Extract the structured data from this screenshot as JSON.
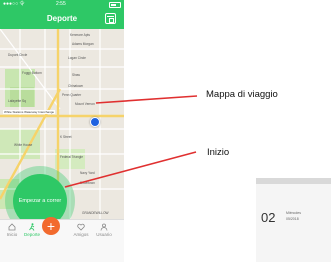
{
  "status_bar": {
    "carrier": "●●●○○ 令",
    "time": "2:55"
  },
  "nav": {
    "title": "Deporte",
    "calendar_icon": "calendar-icon"
  },
  "map": {
    "labels": [
      "Kenmore Apts",
      "Adams Morgan",
      "Dupont Circle",
      "Logan Circle",
      "Foggy Bottom",
      "Shaw",
      "Chinatown",
      "Penn Quarter",
      "Lafayette Sq",
      "Mount Vernon",
      "K Street",
      "White House",
      "Federal Triangle",
      "Navy Yard",
      "Downtown",
      "GRANDEWILLOW"
    ],
    "street_label": "White Stations Waterway Interchange"
  },
  "start_button": {
    "label": "Empezar a correr"
  },
  "tabs": [
    {
      "label": "Inicio",
      "icon": "home-icon"
    },
    {
      "label": "Deporte",
      "icon": "runner-icon"
    },
    {
      "label": "",
      "icon": "plus-icon"
    },
    {
      "label": "Amigos",
      "icon": "heart-icon"
    },
    {
      "label": "Usuario",
      "icon": "user-icon"
    }
  ],
  "annotations": {
    "map": "Mappa di viaggio",
    "start": "Inizio"
  },
  "second_screen": {
    "day": "02",
    "line1": "Miércoles",
    "line2": "05/2018"
  },
  "colors": {
    "brand_green": "#2ec866",
    "plus_orange": "#f26a2e",
    "annotation_red": "#e03030",
    "location_blue": "#1f62e0"
  }
}
